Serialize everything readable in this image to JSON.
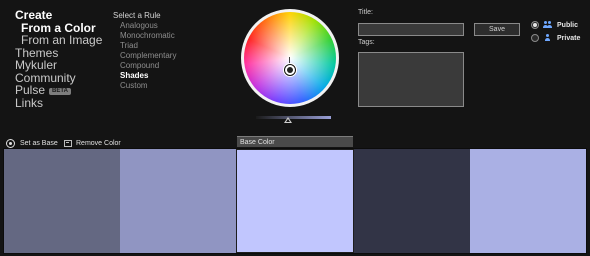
{
  "nav": {
    "create": "Create",
    "from_color": "From a Color",
    "from_image": "From an Image",
    "themes": "Themes",
    "mykuler": "Mykuler",
    "community": "Community",
    "pulse": "Pulse",
    "pulse_badge": "BETA",
    "links": "Links"
  },
  "rules": {
    "title": "Select a Rule",
    "options": [
      "Analogous",
      "Monochromatic",
      "Triad",
      "Complementary",
      "Compound",
      "Shades",
      "Custom"
    ],
    "selected": "Shades"
  },
  "form": {
    "title_label": "Title:",
    "title_value": "",
    "tags_label": "Tags:",
    "tags_value": "",
    "save_label": "Save"
  },
  "visibility": {
    "public_label": "Public",
    "private_label": "Private",
    "selected": "Public"
  },
  "actions": {
    "set_as_base": "Set as Base",
    "remove_color": "Remove Color",
    "base_color_label": "Base Color"
  },
  "colors": {
    "swatches": [
      "#646882",
      "#9095c2",
      "#c1c6fe",
      "#323446",
      "#aab0e4"
    ],
    "base_index": 2,
    "bg": "#141414"
  },
  "icons": {
    "set_as_base": "target-icon",
    "remove_color": "remove-icon",
    "public": "group-icon",
    "private": "person-icon"
  }
}
